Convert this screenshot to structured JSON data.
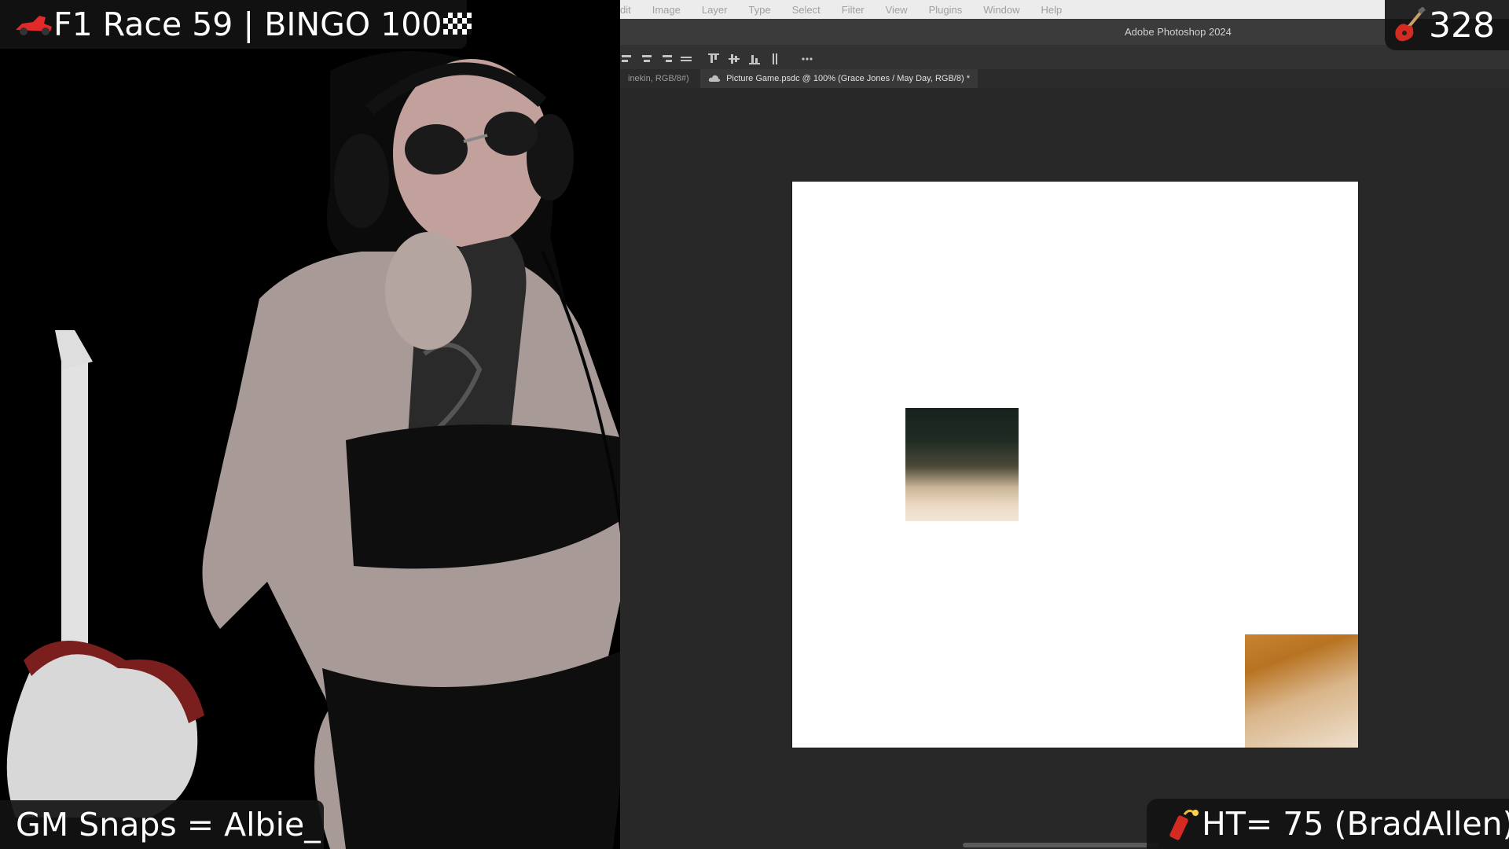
{
  "overlays": {
    "top_left": {
      "text": "F1 Race 59 | BINGO 100",
      "icons": [
        "race-car-icon",
        "checkered-flag-icon"
      ]
    },
    "top_right": {
      "text": "328",
      "icon": "guitar-icon"
    },
    "bottom_left": {
      "text": "GM Snaps = Albie_"
    },
    "bottom_right": {
      "text": "HT= 75 (BradAllen)",
      "icon": "firecracker-icon"
    }
  },
  "photoshop": {
    "app_title": "Adobe Photoshop 2024",
    "menu": [
      "dit",
      "Image",
      "Layer",
      "Type",
      "Select",
      "Filter",
      "View",
      "Plugins",
      "Window",
      "Help"
    ],
    "options_icons": [
      "align-left-icon",
      "align-center-icon",
      "align-right-icon",
      "distribute-icon",
      "align-top-icon",
      "align-middle-icon",
      "align-bottom-icon",
      "distribute-vertical-icon",
      "more-options-icon"
    ],
    "tabs": [
      {
        "label": "inekin, RGB/8#)",
        "active": false
      },
      {
        "label": "Picture Game.psdc @ 100% (Grace Jones / May Day, RGB/8) *",
        "active": true,
        "icon": "cloud-icon"
      }
    ]
  },
  "colors": {
    "menubar_bg": "#ececec",
    "workspace_bg": "#282828",
    "canvas_bg": "#ffffff",
    "overlay_bg": "#121212",
    "overlay_text": "#ffffff",
    "firecracker": "#d42a22"
  }
}
